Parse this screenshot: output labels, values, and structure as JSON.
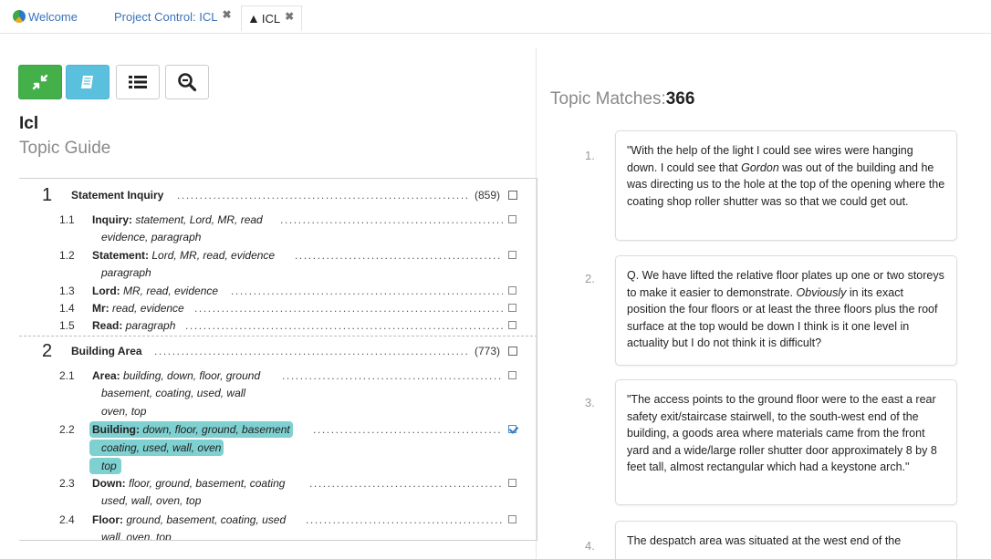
{
  "tabs": {
    "welcome": "Welcome",
    "project": "Project Control: ICL",
    "icl": "ICL",
    "close_glyph": "✖"
  },
  "doc": {
    "title": "Icl",
    "subtitle": "Topic Guide"
  },
  "guide": {
    "sections": [
      {
        "num": "1",
        "label": "Statement Inquiry",
        "count": "(859)"
      },
      {
        "num": "2",
        "label": "Building Area",
        "count": "(773)"
      }
    ],
    "items": [
      {
        "num": "1.1",
        "label": "Inquiry:",
        "kw1": " statement, Lord, MR, read",
        "kw2": "evidence, paragraph",
        "kw3": ""
      },
      {
        "num": "1.2",
        "label": "Statement:",
        "kw1": " Lord, MR, read, evidence",
        "kw2": "paragraph",
        "kw3": ""
      },
      {
        "num": "1.3",
        "label": "Lord:",
        "kw1": " MR, read, evidence",
        "kw2": "",
        "kw3": ""
      },
      {
        "num": "1.4",
        "label": "Mr:",
        "kw1": " read, evidence",
        "kw2": "",
        "kw3": ""
      },
      {
        "num": "1.5",
        "label": "Read:",
        "kw1": " paragraph",
        "kw2": "",
        "kw3": ""
      },
      {
        "num": "2.1",
        "label": "Area:",
        "kw1": " building, down, floor, ground",
        "kw2": "basement, coating, used, wall",
        "kw3": "oven, top"
      },
      {
        "num": "2.2",
        "label": "Building:",
        "kw1": " down, floor, ground, basement",
        "kw2": "coating, used, wall, oven",
        "kw3": "top"
      },
      {
        "num": "2.3",
        "label": "Down:",
        "kw1": " floor, ground, basement, coating",
        "kw2": "used, wall, oven, top",
        "kw3": ""
      },
      {
        "num": "2.4",
        "label": "Floor:",
        "kw1": " ground, basement, coating, used",
        "kw2": "wall, oven, top",
        "kw3": ""
      }
    ]
  },
  "matches": {
    "label": "Topic Matches:",
    "count": "366",
    "items": [
      {
        "num": "1.",
        "pre": "\"With the help of the light I could see wires were hanging down. I could see that ",
        "em": "Gordon",
        "post": " was out of the building and he was directing us to the hole at the top of the opening where the coating shop roller shutter was so that we could get out."
      },
      {
        "num": "2.",
        "pre": "Q. We have lifted the relative floor plates up one or two storeys to make it easier to demonstrate. ",
        "em": "Obviously",
        "post": " in its exact position the four floors or at least the three floors plus the roof surface at the top would be down I think is it one level in actuality but I do not think it is difficult?"
      },
      {
        "num": "3.",
        "pre": "\"The access points to the ground floor were to the east a rear safety exit/staircase stairwell, to the south-west end of the building, a goods area where materials came from the front yard and a wide/large roller shutter door approximately 8 by 8 feet tall, almost rectangular which had a keystone arch.\"",
        "em": "",
        "post": ""
      },
      {
        "num": "4.",
        "pre": "The despatch area was situated at the west end of the",
        "em": "",
        "post": ""
      }
    ]
  },
  "colors": {
    "accent_green": "#43b04a",
    "accent_blue": "#5bc0de",
    "highlight": "#7fd0d1",
    "link": "#3a73b8"
  },
  "icons": [
    "globe-icon",
    "close-icon",
    "icl-logo-icon",
    "collapse-icon",
    "book-icon",
    "list-icon",
    "search-minus-icon",
    "checkbox-icon"
  ]
}
